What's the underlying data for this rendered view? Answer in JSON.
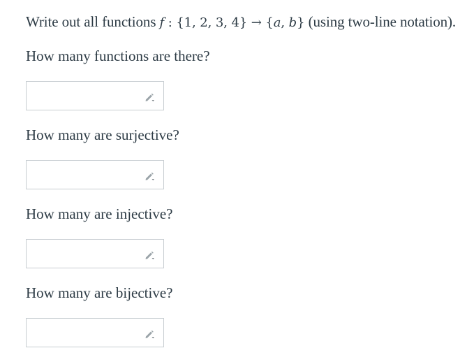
{
  "prompt": {
    "text_before": "Write out all functions ",
    "math_f": "f",
    "math_mapping": " : {1, 2, 3, 4} → {",
    "math_a": "a",
    "math_comma": ", ",
    "math_b": "b",
    "math_close": "}",
    "text_after": " (using two-line notation)."
  },
  "questions": [
    {
      "label": "How many functions are there?",
      "answer": ""
    },
    {
      "label": "How many are surjective?",
      "answer": ""
    },
    {
      "label": "How many are injective?",
      "answer": ""
    },
    {
      "label": "How many are bijective?",
      "answer": ""
    }
  ],
  "icons": {
    "edit": "pencil-dropdown-icon"
  },
  "colors": {
    "text": "#2d3b45",
    "box_border": "#c7cdd1",
    "icon": "#9aa3a8"
  }
}
